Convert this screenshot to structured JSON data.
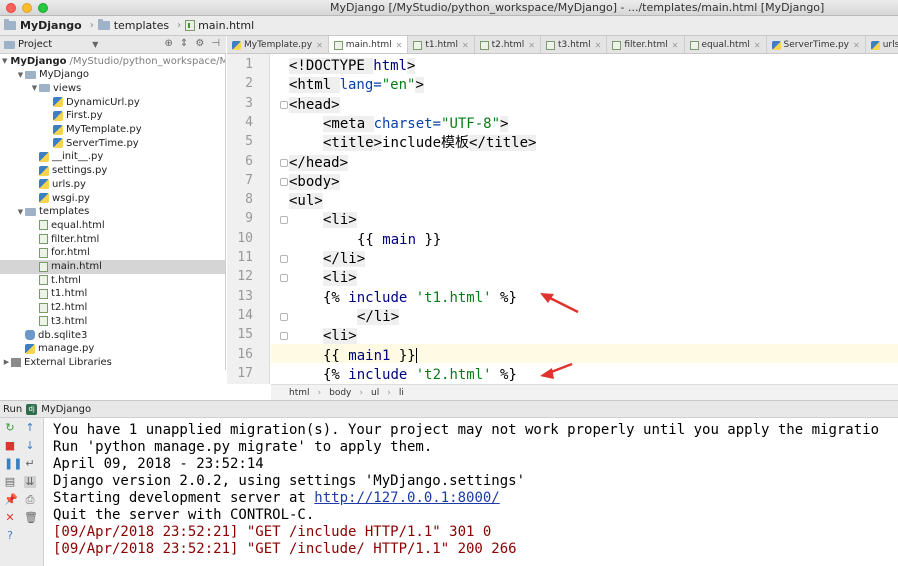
{
  "window": {
    "title": "MyDjango [/MyStudio/python_workspace/MyDjango] - .../templates/main.html [MyDjango]"
  },
  "breadcrumb": {
    "project": "MyDjango",
    "folder": "templates",
    "file": "main.html"
  },
  "project_panel": {
    "title": "Project",
    "tree": [
      {
        "label": "MyDjango",
        "extra": "/MyStudio/python_workspace/M",
        "type": "folder",
        "depth": 0,
        "open": true,
        "bold": true
      },
      {
        "label": "MyDjango",
        "type": "folder",
        "depth": 1,
        "open": true
      },
      {
        "label": "views",
        "type": "folder",
        "depth": 2,
        "open": true
      },
      {
        "label": "DynamicUrl.py",
        "type": "py",
        "depth": 3
      },
      {
        "label": "First.py",
        "type": "py",
        "depth": 3
      },
      {
        "label": "MyTemplate.py",
        "type": "py",
        "depth": 3
      },
      {
        "label": "ServerTime.py",
        "type": "py",
        "depth": 3
      },
      {
        "label": "__init__.py",
        "type": "py",
        "depth": 2
      },
      {
        "label": "settings.py",
        "type": "py",
        "depth": 2
      },
      {
        "label": "urls.py",
        "type": "py",
        "depth": 2
      },
      {
        "label": "wsgi.py",
        "type": "py",
        "depth": 2
      },
      {
        "label": "templates",
        "type": "folder",
        "depth": 1,
        "open": true
      },
      {
        "label": "equal.html",
        "type": "html",
        "depth": 2
      },
      {
        "label": "filter.html",
        "type": "html",
        "depth": 2
      },
      {
        "label": "for.html",
        "type": "html",
        "depth": 2
      },
      {
        "label": "main.html",
        "type": "html",
        "depth": 2,
        "selected": true
      },
      {
        "label": "t.html",
        "type": "html",
        "depth": 2
      },
      {
        "label": "t1.html",
        "type": "html",
        "depth": 2
      },
      {
        "label": "t2.html",
        "type": "html",
        "depth": 2
      },
      {
        "label": "t3.html",
        "type": "html",
        "depth": 2
      },
      {
        "label": "db.sqlite3",
        "type": "db",
        "depth": 1
      },
      {
        "label": "manage.py",
        "type": "py",
        "depth": 1
      },
      {
        "label": "External Libraries",
        "type": "lib",
        "depth": 0,
        "open": false
      }
    ]
  },
  "tabs": [
    {
      "label": "MyTemplate.py",
      "type": "py"
    },
    {
      "label": "main.html",
      "type": "html",
      "active": true
    },
    {
      "label": "t1.html",
      "type": "html"
    },
    {
      "label": "t2.html",
      "type": "html"
    },
    {
      "label": "t3.html",
      "type": "html"
    },
    {
      "label": "filter.html",
      "type": "html"
    },
    {
      "label": "equal.html",
      "type": "html"
    },
    {
      "label": "ServerTime.py",
      "type": "py"
    },
    {
      "label": "urls.py",
      "type": "py"
    }
  ],
  "editor": {
    "line_numbers": [
      "1",
      "2",
      "3",
      "4",
      "5",
      "6",
      "7",
      "8",
      "9",
      "10",
      "11",
      "12",
      "13",
      "14",
      "15",
      "16",
      "17"
    ],
    "lines": [
      {
        "indent": 0,
        "parts": [
          [
            "tag",
            "<!DOCTYPE "
          ],
          [
            "kw",
            "html"
          ],
          [
            "tag",
            ">"
          ]
        ]
      },
      {
        "indent": 0,
        "parts": [
          [
            "tag",
            "<html "
          ],
          [
            "attr",
            "lang="
          ],
          [
            "str",
            "\"en\""
          ],
          [
            "tag",
            ">"
          ]
        ]
      },
      {
        "indent": 0,
        "parts": [
          [
            "tag",
            "<head>"
          ]
        ]
      },
      {
        "indent": 1,
        "parts": [
          [
            "tag",
            "<meta "
          ],
          [
            "attr",
            "charset="
          ],
          [
            "str",
            "\"UTF-8\""
          ],
          [
            "tag",
            ">"
          ]
        ]
      },
      {
        "indent": 1,
        "parts": [
          [
            "tag",
            "<title>"
          ],
          [
            "tpl",
            "include模板"
          ],
          [
            "tag",
            "</title>"
          ]
        ]
      },
      {
        "indent": 0,
        "parts": [
          [
            "tag",
            "</head>"
          ]
        ]
      },
      {
        "indent": 0,
        "parts": [
          [
            "tag",
            "<body>"
          ]
        ]
      },
      {
        "indent": 0,
        "parts": [
          [
            "tag",
            "<ul>"
          ]
        ]
      },
      {
        "indent": 1,
        "parts": [
          [
            "tag",
            "<li>"
          ]
        ]
      },
      {
        "indent": 2,
        "parts": [
          [
            "tpl",
            "{{ "
          ],
          [
            "kw",
            "main"
          ],
          [
            "tpl",
            " }}"
          ]
        ]
      },
      {
        "indent": 1,
        "parts": [
          [
            "tag",
            "</li>"
          ]
        ]
      },
      {
        "indent": 1,
        "parts": [
          [
            "tag",
            "<li>"
          ]
        ]
      },
      {
        "indent": 1,
        "parts": [
          [
            "tpl",
            "{% "
          ],
          [
            "kw",
            "include "
          ],
          [
            "str",
            "'t1.html'"
          ],
          [
            "tpl",
            " %}"
          ]
        ]
      },
      {
        "indent": 2,
        "parts": [
          [
            "tag",
            "</li>"
          ]
        ]
      },
      {
        "indent": 1,
        "parts": [
          [
            "tag",
            "<li>"
          ]
        ]
      },
      {
        "indent": 1,
        "parts": [
          [
            "tpl",
            "{{ "
          ],
          [
            "kw",
            "main1"
          ],
          [
            "tpl",
            " }}"
          ]
        ],
        "caret": true
      },
      {
        "indent": 1,
        "parts": [
          [
            "tpl",
            "{% "
          ],
          [
            "kw",
            "include "
          ],
          [
            "str",
            "'t2.html'"
          ],
          [
            "tpl",
            " %}"
          ]
        ]
      }
    ],
    "breadcrumb": [
      "html",
      "body",
      "ul",
      "li"
    ]
  },
  "run": {
    "label": "Run",
    "config": "MyDjango",
    "output": {
      "line1": "You have 1 unapplied migration(s). Your project may not work properly until you apply the migratio",
      "line2": "Run 'python manage.py migrate' to apply them.",
      "line3": "April 09, 2018 - 23:52:14",
      "line4": "Django version 2.0.2, using settings 'MyDjango.settings'",
      "line5_prefix": "Starting development server at ",
      "line5_link": "http://127.0.0.1:8000/",
      "line6": "Quit the server with CONTROL-C.",
      "line7": "[09/Apr/2018 23:52:21] \"GET /include HTTP/1.1\" 301 0",
      "line8": "[09/Apr/2018 23:52:21] \"GET /include/ HTTP/1.1\" 200 266"
    }
  },
  "colors": {
    "arrow": "#e0322e",
    "tag_bg": "#efefef",
    "current_line": "#fffae3"
  }
}
